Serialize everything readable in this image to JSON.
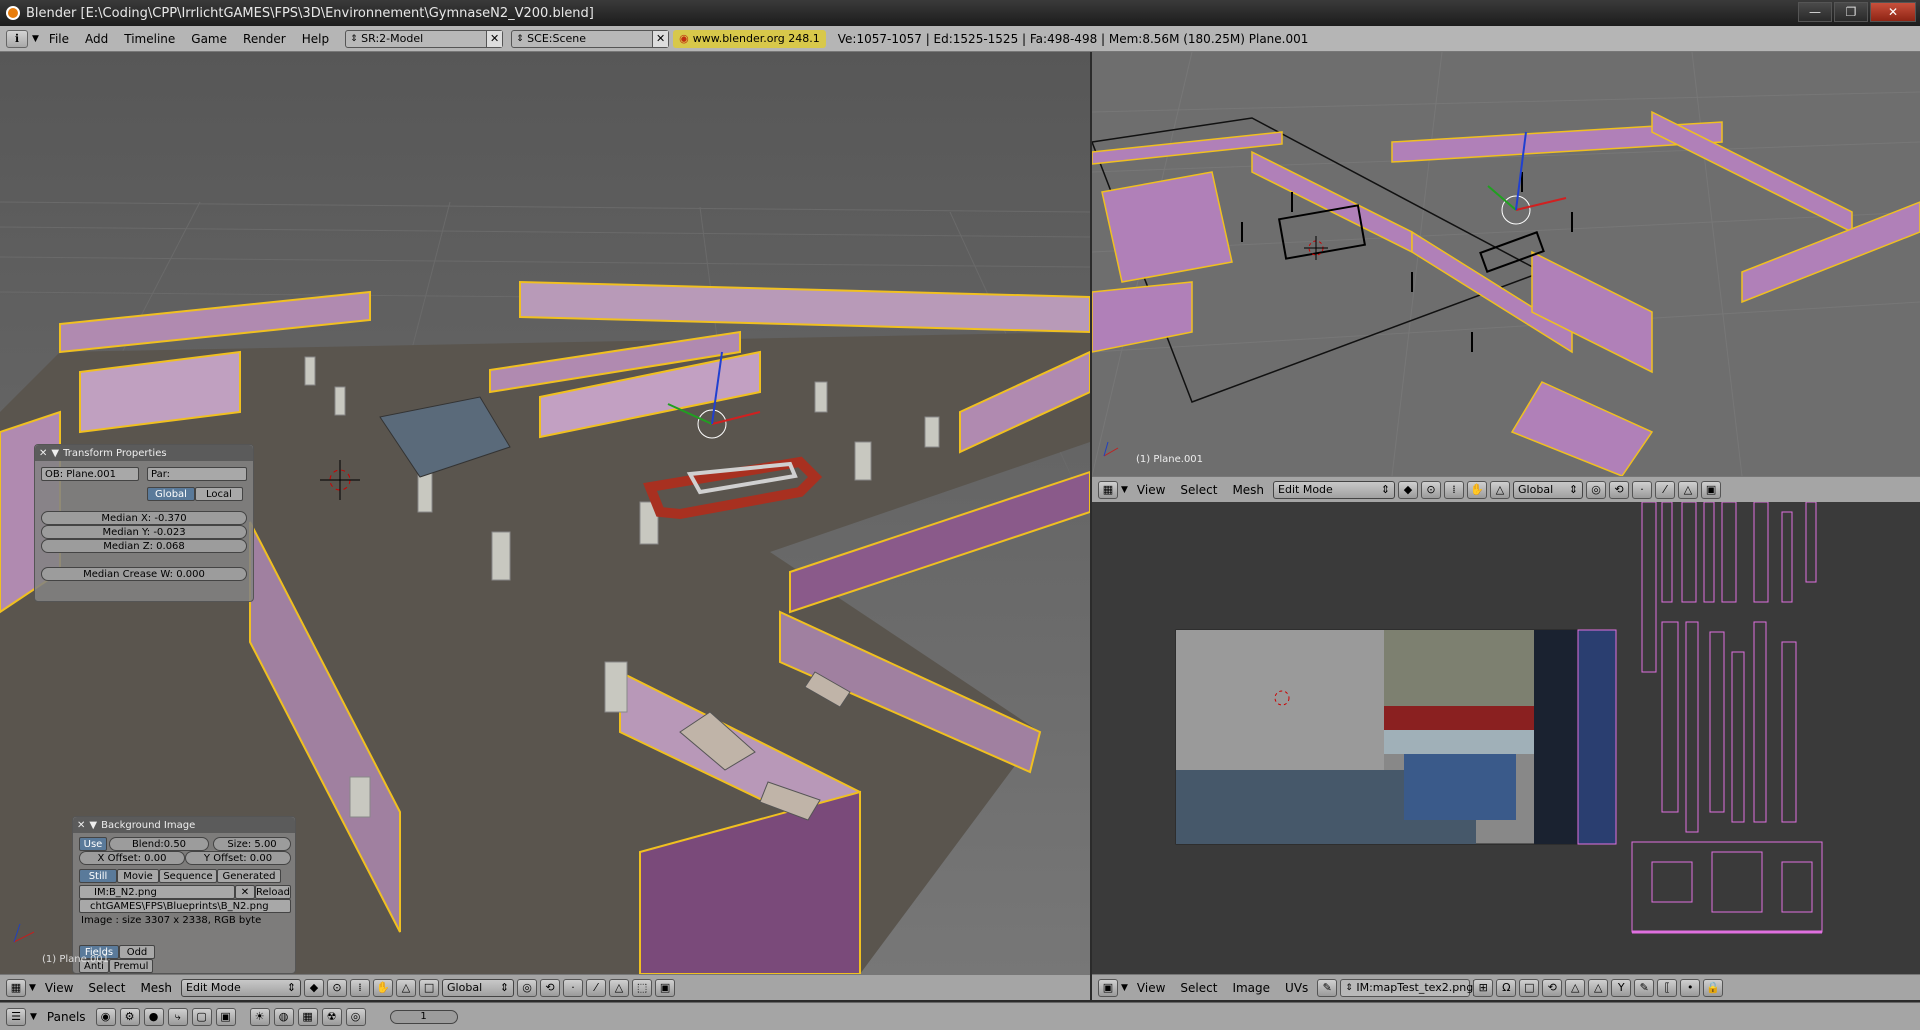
{
  "window": {
    "title": "Blender [E:\\Coding\\CPP\\IrrlichtGAMES\\FPS\\3D\\Environnement\\GymnaseN2_V200.blend]",
    "min": "—",
    "max": "❐",
    "close": "✕"
  },
  "info": {
    "menus": [
      "File",
      "Add",
      "Timeline",
      "Game",
      "Render",
      "Help"
    ],
    "screen": "SR:2-Model",
    "scene": "SCE:Scene",
    "url": "www.blender.org 248.1",
    "stats": "Ve:1057-1057 | Ed:1525-1525 | Fa:498-498 | Mem:8.56M (180.25M) Plane.001"
  },
  "left_view": {
    "menus": [
      "View",
      "Select",
      "Mesh"
    ],
    "mode": "Edit Mode",
    "orientation": "Global",
    "object_label": "(1) Plane.001",
    "transform": {
      "title": "Transform Properties",
      "ob": "OB: Plane.001",
      "par": "Par:",
      "global": "Global",
      "local": "Local",
      "mx": "Median X: -0.370",
      "my": "Median Y: -0.023",
      "mz": "Median Z: 0.068",
      "crease": "Median Crease W: 0.000"
    },
    "bgimage": {
      "title": "Background Image",
      "use": "Use",
      "blend": "Blend:0.50",
      "size": "Size: 5.00",
      "xoff": "X Offset: 0.00",
      "yoff": "Y Offset: 0.00",
      "still": "Still",
      "movie": "Movie",
      "sequence": "Sequence",
      "generated": "Generated",
      "im": "IM:B_N2.png",
      "reload": "Reload",
      "path": "chtGAMES\\FPS\\Blueprints\\B_N2.png",
      "info": "Image : size 3307 x 2338, RGB byte",
      "fields": "Fields",
      "odd": "Odd",
      "anti": "Anti",
      "premul": "Premul"
    }
  },
  "right_top": {
    "object_label": "(1) Plane.001",
    "menus": [
      "View",
      "Select",
      "Mesh"
    ],
    "mode": "Edit Mode",
    "orientation": "Global"
  },
  "uv_editor": {
    "menus": [
      "View",
      "Select",
      "Image",
      "UVs"
    ],
    "image": "IM:mapTest_tex2.png"
  },
  "bottom": {
    "panels": "Panels",
    "frame": "1"
  },
  "colors": {
    "wall_fill": "#b08ab0",
    "wall_edge": "#f0c020",
    "floor": "#5a554e",
    "grid_bg": "#6e6e6e",
    "uv_bg": "#3a3a3a",
    "uv_edge": "#e070e0"
  }
}
